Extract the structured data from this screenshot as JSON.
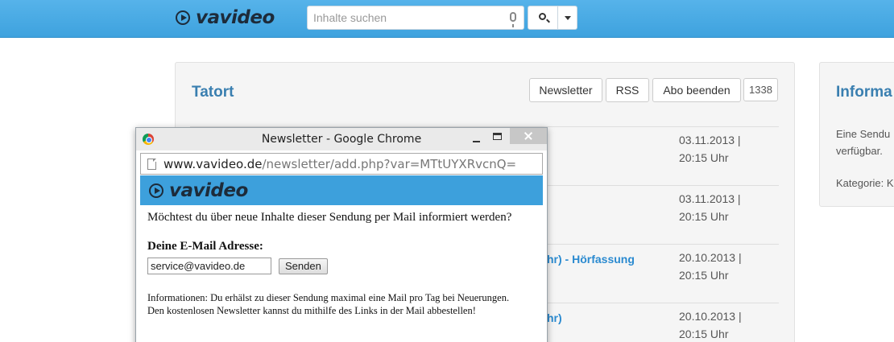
{
  "header": {
    "logo_text": "vavideo",
    "search_placeholder": "Inhalte suchen",
    "icons": [
      "play-logo-icon",
      "microphone-icon",
      "search-icon",
      "caret-down-icon"
    ],
    "brand_color": "#3ea2de"
  },
  "main": {
    "title": "Tatort",
    "buttons": {
      "newsletter": "Newsletter",
      "rss": "RSS",
      "unsubscribe": "Abo beenden"
    },
    "count": "1338",
    "rows": [
      {
        "title": "",
        "date": "03.11.2013 |",
        "time": "20:15 Uhr"
      },
      {
        "title": "",
        "date": "03.11.2013 |",
        "time": "20:15 Uhr"
      },
      {
        "title": "hr) - Hörfassung",
        "date": "20.10.2013 |",
        "time": "20:15 Uhr"
      },
      {
        "title": "hr)",
        "date": "20.10.2013 |",
        "time": "20:15 Uhr"
      }
    ]
  },
  "sidebar": {
    "title": "Informa",
    "text_line1": "Eine Sendu",
    "text_line2": "verfügbar.",
    "category": "Kategorie: K"
  },
  "popup": {
    "window_title": "Newsletter - Google Chrome",
    "url_host": "www.vavideo.de",
    "url_path": "/newsletter/add.php?var=MTtUYXRvcnQ=",
    "logo_text": "vavideo",
    "question": "Möchtest du über neue Inhalte dieser Sendung per Mail informiert werden?",
    "email_label": "Deine E-Mail Adresse:",
    "email_value": "service@vavideo.de",
    "send_label": "Senden",
    "info_line1": "Informationen: Du erhälst zu dieser Sendung maximal eine Mail pro Tag bei Neuerungen.",
    "info_line2": "Den kostenlosen Newsletter kannst du mithilfe des Links in der Mail abbestellen!"
  }
}
